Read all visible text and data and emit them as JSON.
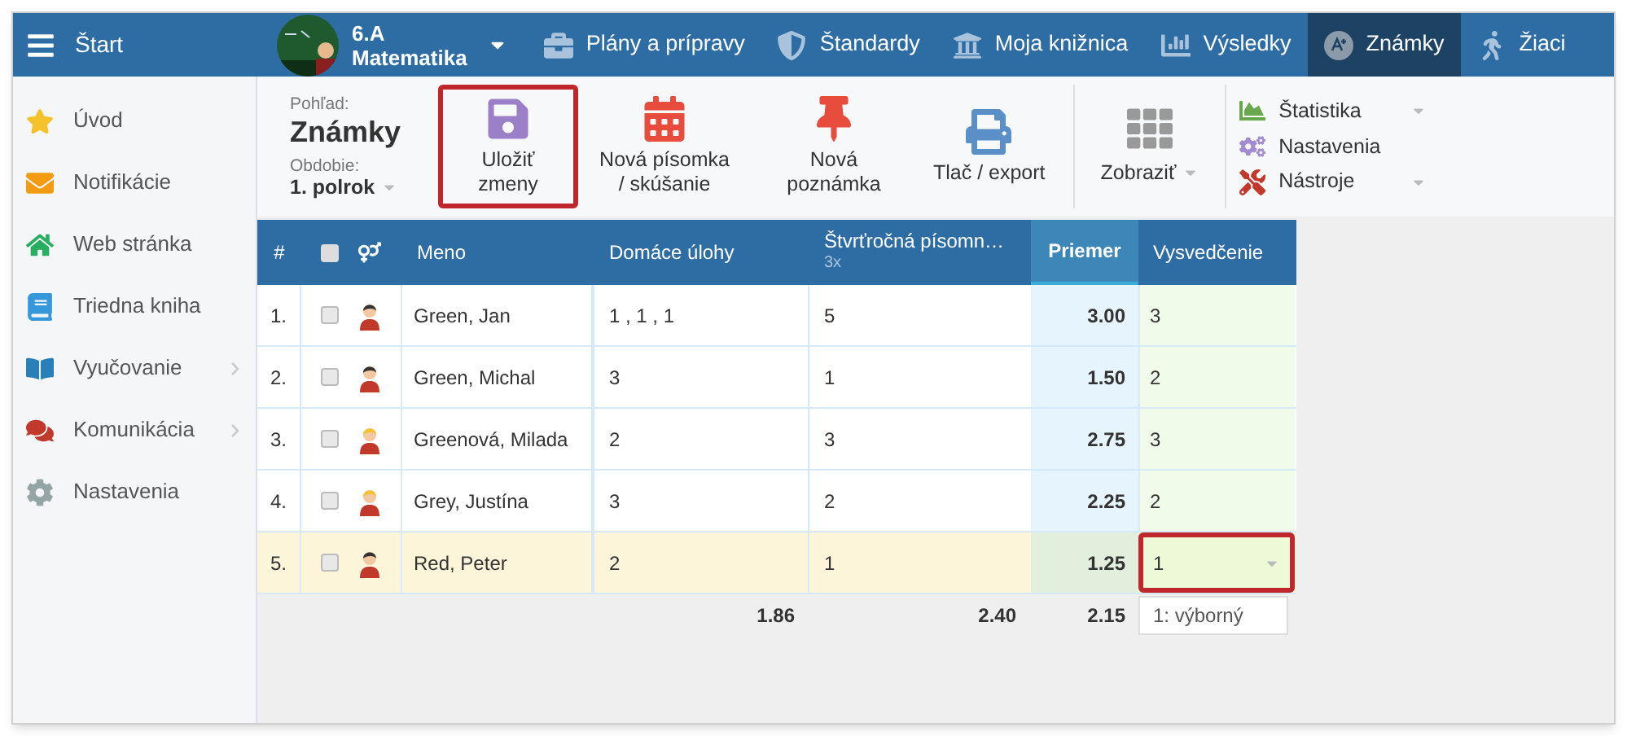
{
  "topbar": {
    "menu_label": "Štart",
    "class_name": "6.A",
    "subject": "Matematika",
    "tabs": [
      {
        "label": "Plány a prípravy",
        "selected": false
      },
      {
        "label": "Štandardy",
        "selected": false
      },
      {
        "label": "Moja knižnica",
        "selected": false
      },
      {
        "label": "Výsledky",
        "selected": false
      },
      {
        "label": "Známky",
        "selected": true
      },
      {
        "label": "Žiaci",
        "selected": false
      }
    ]
  },
  "sidebar": {
    "items": [
      {
        "label": "Úvod",
        "has_submenu": false
      },
      {
        "label": "Notifikácie",
        "has_submenu": false
      },
      {
        "label": "Web stránka",
        "has_submenu": false
      },
      {
        "label": "Triedna kniha",
        "has_submenu": false
      },
      {
        "label": "Vyučovanie",
        "has_submenu": true
      },
      {
        "label": "Komunikácia",
        "has_submenu": true
      },
      {
        "label": "Nastavenia",
        "has_submenu": false
      }
    ]
  },
  "toolbar": {
    "view_label": "Pohľad:",
    "view_value": "Známky",
    "period_label": "Obdobie:",
    "period_value": "1. polrok",
    "buttons": [
      {
        "label": "Uložiť zmeny",
        "highlighted": true
      },
      {
        "label": "Nová písomka / skúšanie",
        "highlighted": false
      },
      {
        "label": "Nová poznámka",
        "highlighted": false
      },
      {
        "label": "Tlač / export",
        "highlighted": false
      }
    ],
    "display_label": "Zobraziť",
    "menu": [
      {
        "label": "Štatistika",
        "has_dropdown": true
      },
      {
        "label": "Nastavenia",
        "has_dropdown": false
      },
      {
        "label": "Nástroje",
        "has_dropdown": true
      }
    ]
  },
  "table": {
    "select_all_checked": false,
    "columns": [
      {
        "label": "#"
      },
      {
        "label": "Meno"
      },
      {
        "label": "Domáce úlohy"
      },
      {
        "label": "Štvrťročná písomn…",
        "sub": "3x"
      },
      {
        "label": "Priemer"
      },
      {
        "label": "Vysvedčenie"
      }
    ],
    "rows": [
      {
        "number": "1.",
        "checked": false,
        "kind": "male",
        "name": "Green, Jan",
        "homework": "1 , 1 , 1",
        "quarterly": "5",
        "average": "3.00",
        "grade": "3",
        "selected": false,
        "highlighted": false
      },
      {
        "number": "2.",
        "checked": false,
        "kind": "male",
        "name": "Green, Michal",
        "homework": "3",
        "quarterly": "1",
        "average": "1.50",
        "grade": "2",
        "selected": false,
        "highlighted": false
      },
      {
        "number": "3.",
        "checked": false,
        "kind": "female",
        "name": "Greenová, Milada",
        "homework": "2",
        "quarterly": "3",
        "average": "2.75",
        "grade": "3",
        "selected": false,
        "highlighted": false
      },
      {
        "number": "4.",
        "checked": false,
        "kind": "female",
        "name": "Grey, Justína",
        "homework": "3",
        "quarterly": "2",
        "average": "2.25",
        "grade": "2",
        "selected": false,
        "highlighted": false
      },
      {
        "number": "5.",
        "checked": false,
        "kind": "male",
        "name": "Red, Peter",
        "homework": "2",
        "quarterly": "1",
        "average": "1.25",
        "grade": "1",
        "selected": true,
        "highlighted": true
      }
    ],
    "footer": {
      "homework": "1.86",
      "quarterly": "2.40",
      "average": "2.15"
    },
    "grade_option": "1: výborný"
  }
}
